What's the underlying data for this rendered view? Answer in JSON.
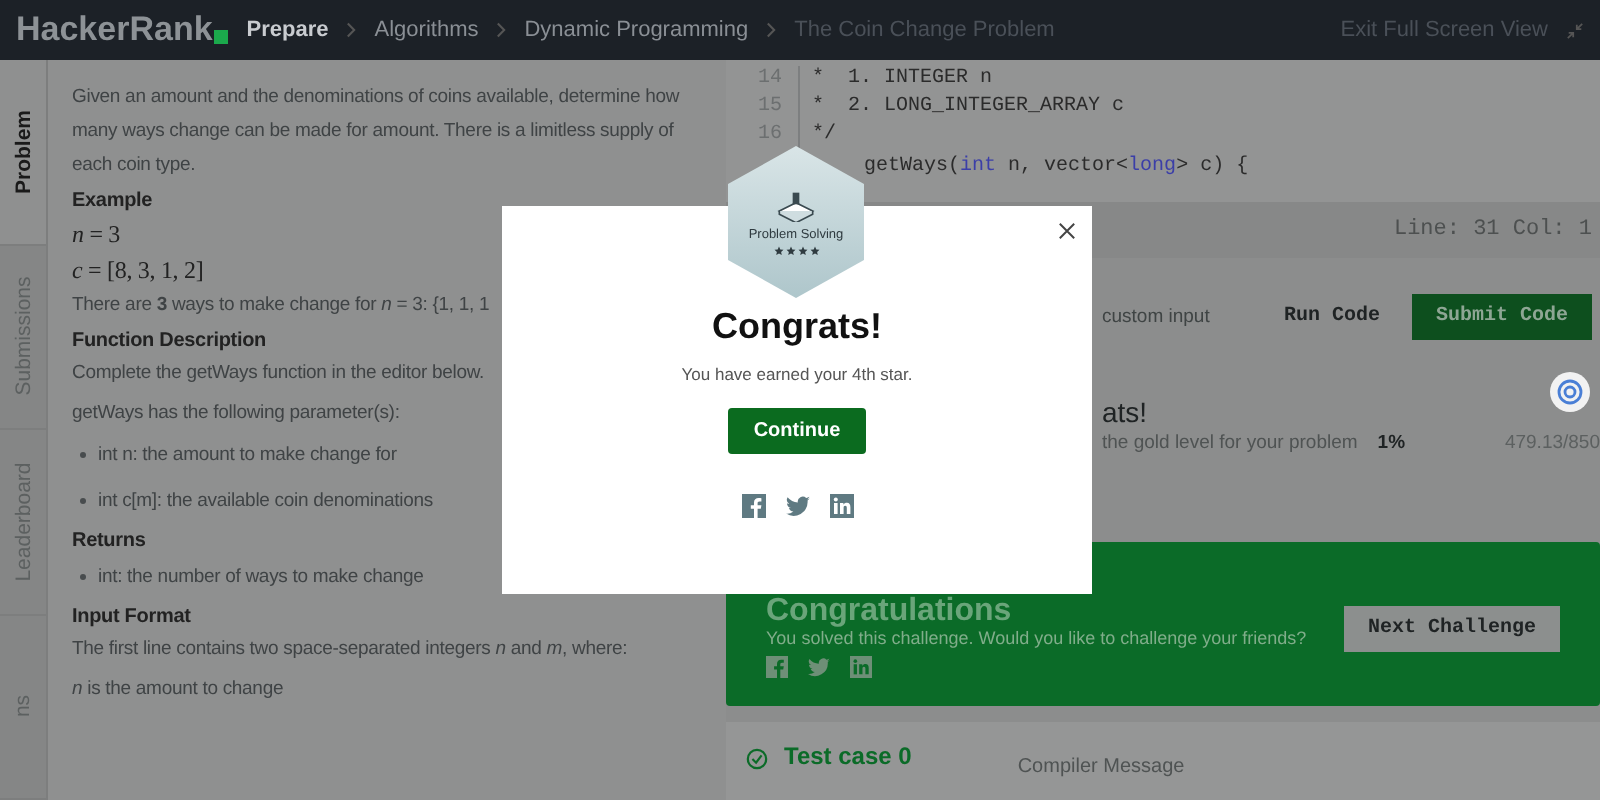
{
  "topbar": {
    "logo": "HackerRank",
    "breadcrumbs": [
      {
        "label": "Prepare",
        "current": false
      },
      {
        "label": "Algorithms",
        "current": false
      },
      {
        "label": "Dynamic Programming",
        "current": false
      },
      {
        "label": "The Coin Change Problem",
        "current": true
      }
    ],
    "exit": "Exit Full Screen View"
  },
  "side_tabs": [
    {
      "label": "Problem",
      "selected": true
    },
    {
      "label": "Submissions",
      "selected": false
    },
    {
      "label": "Leaderboard",
      "selected": false
    },
    {
      "label": "ns",
      "selected": false
    }
  ],
  "problem": [
    {
      "kind": "paragraph",
      "text": "Given an amount and the denominations of coins available, determine how many ways change can be made for amount. There is a limitless supply of each coin type."
    },
    {
      "kind": "heading",
      "text": "Example"
    },
    {
      "kind": "math",
      "text": "*n* = 3"
    },
    {
      "kind": "math",
      "text": "*c* = [8, 3, 1, 2]"
    },
    {
      "kind": "paragraph",
      "text": "There are **3** ways to make change for *n* = 3: {1, 1, 1"
    },
    {
      "kind": "heading",
      "text": "Function Description"
    },
    {
      "kind": "paragraph",
      "text": "Complete the getWays function in the editor below."
    },
    {
      "kind": "paragraph",
      "text": "getWays has the following parameter(s):"
    },
    {
      "kind": "bullet",
      "text": "int n: the amount to make change for"
    },
    {
      "kind": "bullet",
      "text": "int c[m]: the available coin denominations"
    },
    {
      "kind": "heading",
      "text": "Returns"
    },
    {
      "kind": "bullet",
      "text": "int: the number of ways to make change"
    },
    {
      "kind": "heading",
      "text": "Input Format"
    },
    {
      "kind": "paragraph",
      "text": "The first line contains two space-separated integers *n* and *m*, where:"
    },
    {
      "kind": "paragraph",
      "text": "*n* is the amount to change"
    }
  ],
  "editor": {
    "lines": [
      {
        "number": "14",
        "tokens": [
          {
            "kind": "plain",
            "text": "*  1. INTEGER n"
          }
        ]
      },
      {
        "number": "15",
        "tokens": [
          {
            "kind": "plain",
            "text": "*  2. LONG_INTEGER_ARRAY c"
          }
        ]
      },
      {
        "number": "16",
        "tokens": [
          {
            "kind": "plain",
            "text": "*/"
          }
        ]
      },
      {
        "tokens": [
          {
            "kind": "plain",
            "text": "getWays("
          },
          {
            "kind": "keyword",
            "text": "int"
          },
          {
            "kind": "plain",
            "text": " n, vector<"
          },
          {
            "kind": "keyword",
            "text": "long"
          },
          {
            "kind": "plain",
            "text": "> c) {"
          }
        ]
      }
    ],
    "status": "Line: 31 Col: 1"
  },
  "actions": {
    "custom_input": "custom input",
    "run": "Run Code",
    "submit": "Submit Code"
  },
  "progress": {
    "title": "ats!",
    "text": "the gold level for your problem",
    "percent": "1%",
    "score": "479.13/850"
  },
  "banner": {
    "title": "Congratulations",
    "text": "You solved this challenge. Would you like to challenge your friends?",
    "button": "Next Challenge"
  },
  "test_case": {
    "label": "Test case 0",
    "compiler": "Compiler Message"
  },
  "modal": {
    "badge": {
      "label": "Problem Solving",
      "stars": 4
    },
    "title": "Congrats!",
    "text": "You have earned your 4th star.",
    "button": "Continue"
  }
}
